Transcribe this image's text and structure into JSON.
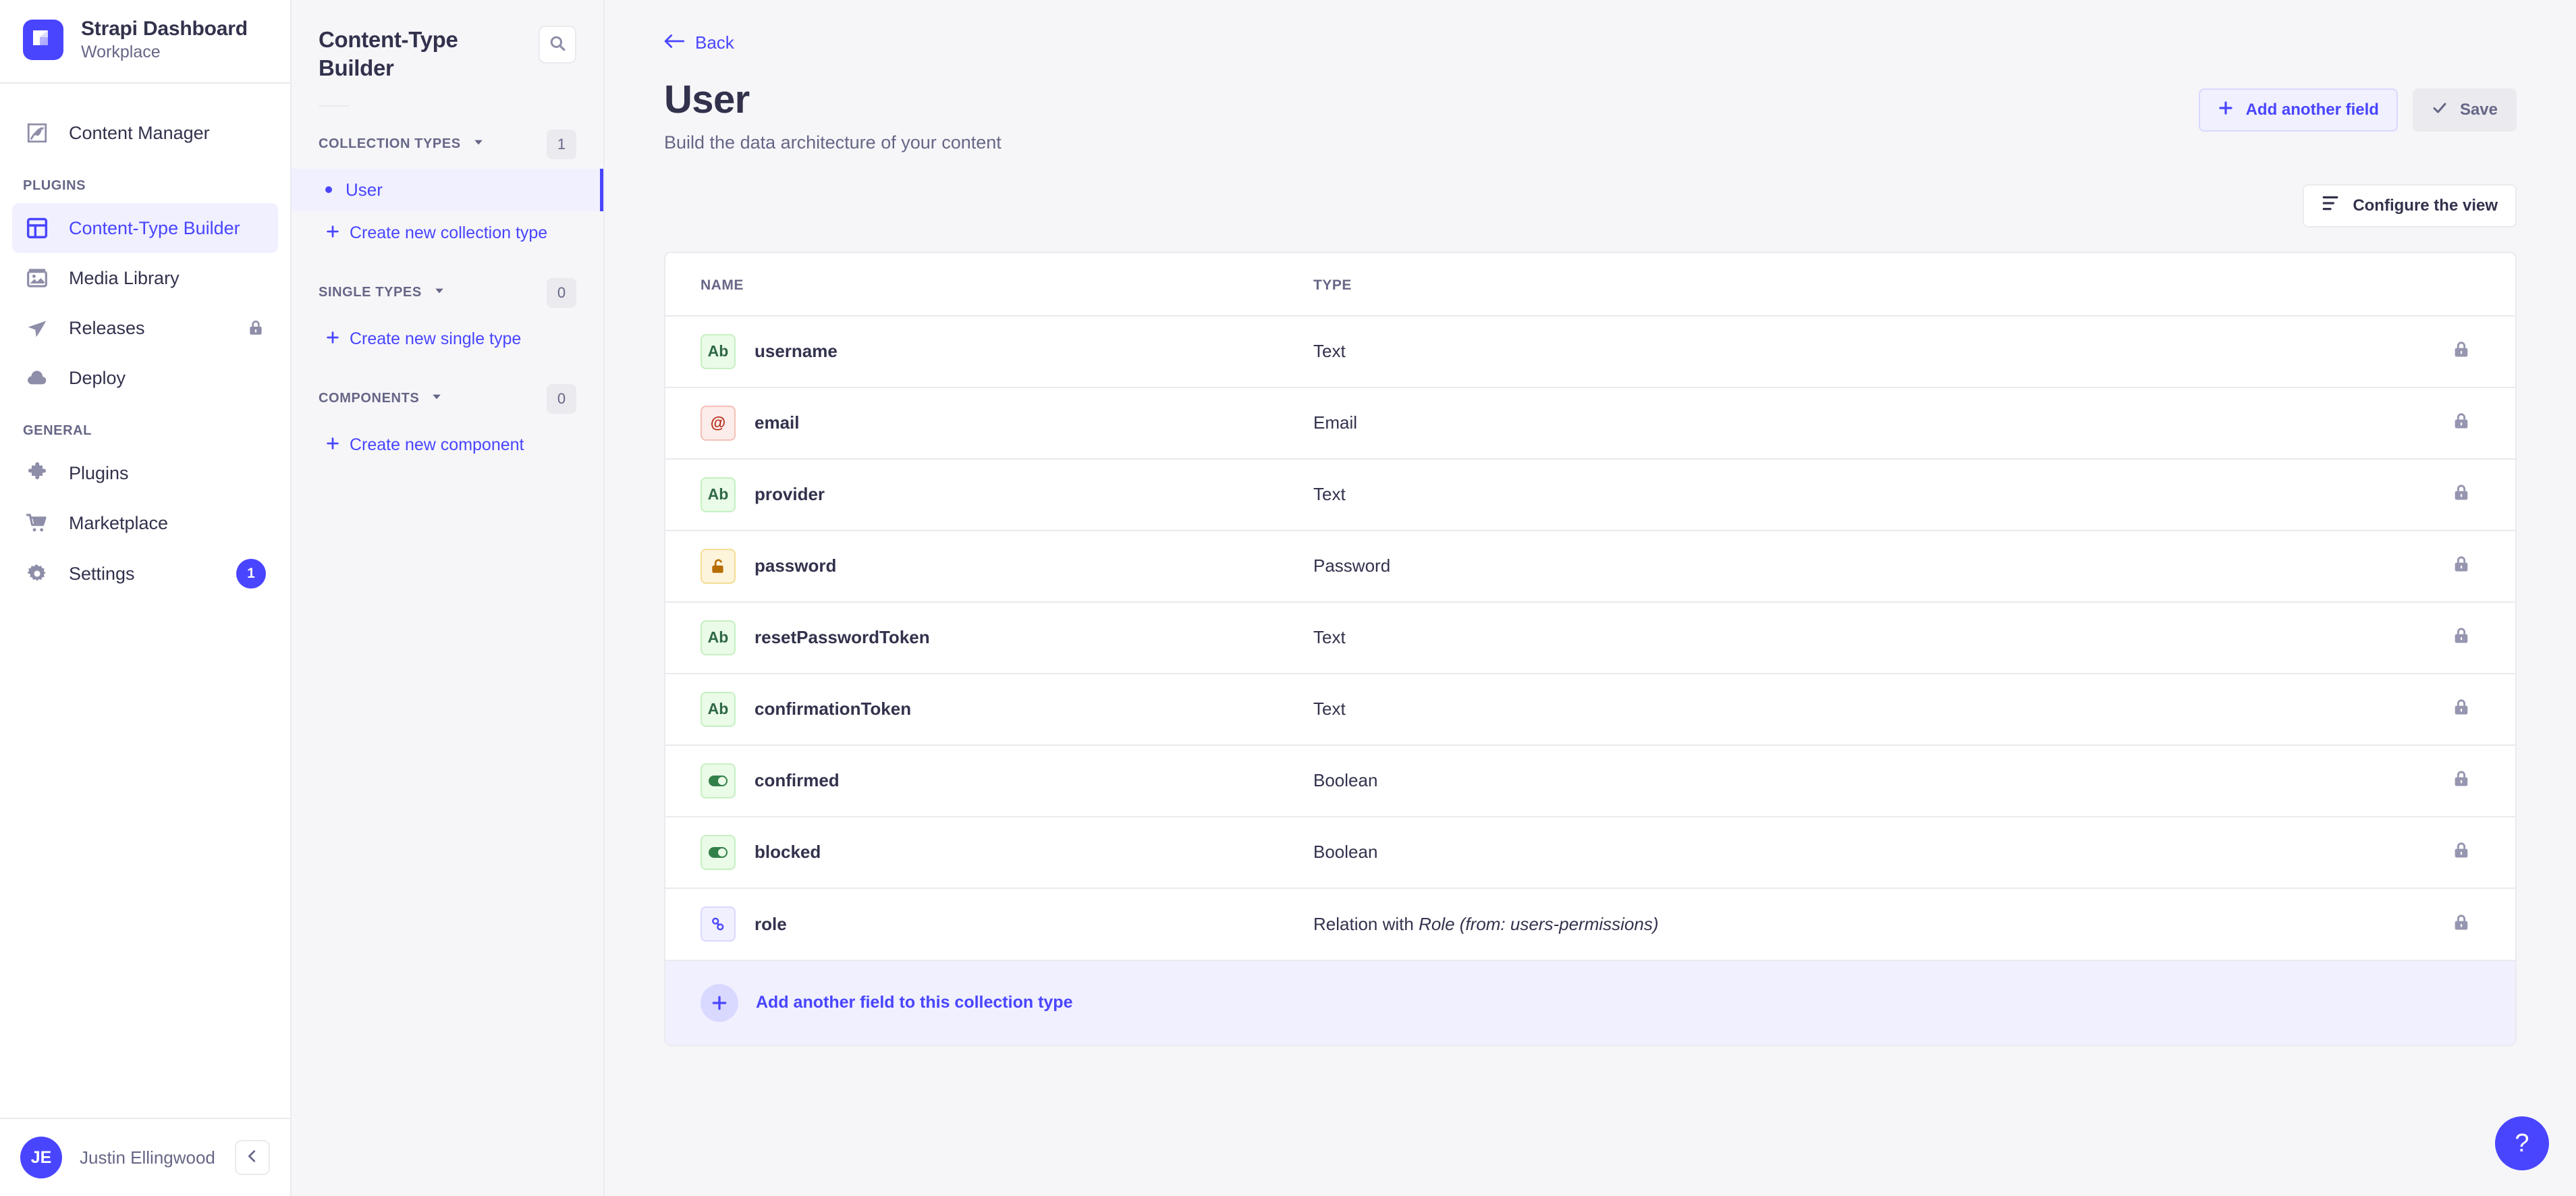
{
  "sidebar": {
    "brand": {
      "title": "Strapi Dashboard",
      "subtitle": "Workplace",
      "logo_color": "#4945ff"
    },
    "top_items": [
      {
        "label": "Content Manager",
        "icon": "pencil-feather-icon"
      }
    ],
    "sections": [
      {
        "label": "PLUGINS",
        "items": [
          {
            "label": "Content-Type Builder",
            "icon": "layout-grid-icon",
            "active": true
          },
          {
            "label": "Media Library",
            "icon": "image-icon",
            "active": false
          },
          {
            "label": "Releases",
            "icon": "paper-plane-icon",
            "active": false,
            "locked": true
          },
          {
            "label": "Deploy",
            "icon": "cloud-icon",
            "active": false
          }
        ]
      },
      {
        "label": "GENERAL",
        "items": [
          {
            "label": "Plugins",
            "icon": "puzzle-icon",
            "active": false
          },
          {
            "label": "Marketplace",
            "icon": "shopping-cart-icon",
            "active": false
          },
          {
            "label": "Settings",
            "icon": "gear-icon",
            "active": false,
            "badge": "1"
          }
        ]
      }
    ],
    "footer": {
      "initials": "JE",
      "name": "Justin Ellingwood",
      "collapse_icon": "chevron-left-icon"
    }
  },
  "subnav": {
    "title": "Content-Type Builder",
    "search_icon": "search-icon",
    "groups": [
      {
        "label": "COLLECTION TYPES",
        "count": "1",
        "items": [
          {
            "label": "User",
            "active": true
          }
        ],
        "create_label": "Create new collection type"
      },
      {
        "label": "SINGLE TYPES",
        "count": "0",
        "items": [],
        "create_label": "Create new single type"
      },
      {
        "label": "COMPONENTS",
        "count": "0",
        "items": [],
        "create_label": "Create new component"
      }
    ]
  },
  "main": {
    "back_label": "Back",
    "page_title": "User",
    "page_subtitle": "Build the data architecture of your content",
    "add_field_button": "Add another field",
    "save_button": "Save",
    "save_disabled": true,
    "configure_button": "Configure the view",
    "table": {
      "columns": {
        "name": "NAME",
        "type": "TYPE"
      },
      "rows": [
        {
          "name": "username",
          "type": "Text",
          "chip": "Ab",
          "chip_kind": "text",
          "locked": true
        },
        {
          "name": "email",
          "type": "Email",
          "chip": "@",
          "chip_kind": "email",
          "locked": true
        },
        {
          "name": "provider",
          "type": "Text",
          "chip": "Ab",
          "chip_kind": "text",
          "locked": true
        },
        {
          "name": "password",
          "type": "Password",
          "chip": "",
          "chip_kind": "password",
          "locked": true
        },
        {
          "name": "resetPasswordToken",
          "type": "Text",
          "chip": "Ab",
          "chip_kind": "text",
          "locked": true
        },
        {
          "name": "confirmationToken",
          "type": "Text",
          "chip": "Ab",
          "chip_kind": "text",
          "locked": true
        },
        {
          "name": "confirmed",
          "type": "Boolean",
          "chip": "",
          "chip_kind": "boolean",
          "locked": true
        },
        {
          "name": "blocked",
          "type": "Boolean",
          "chip": "",
          "chip_kind": "boolean",
          "locked": true
        },
        {
          "name": "role",
          "type": "Relation with Role (from: users-permissions)",
          "type_prefix": "Relation with ",
          "type_italic": "Role (from: users-permissions)",
          "chip": "",
          "chip_kind": "relation",
          "locked": true
        }
      ]
    },
    "add_field_footer": "Add another field to this collection type",
    "help_label": "?"
  },
  "colors": {
    "accent": "#4945ff",
    "accent_light": "#f0f0ff",
    "page_bg": "#f6f6f9",
    "border": "#eaeaef",
    "text_dark": "#32324d",
    "text_muted": "#666687"
  }
}
